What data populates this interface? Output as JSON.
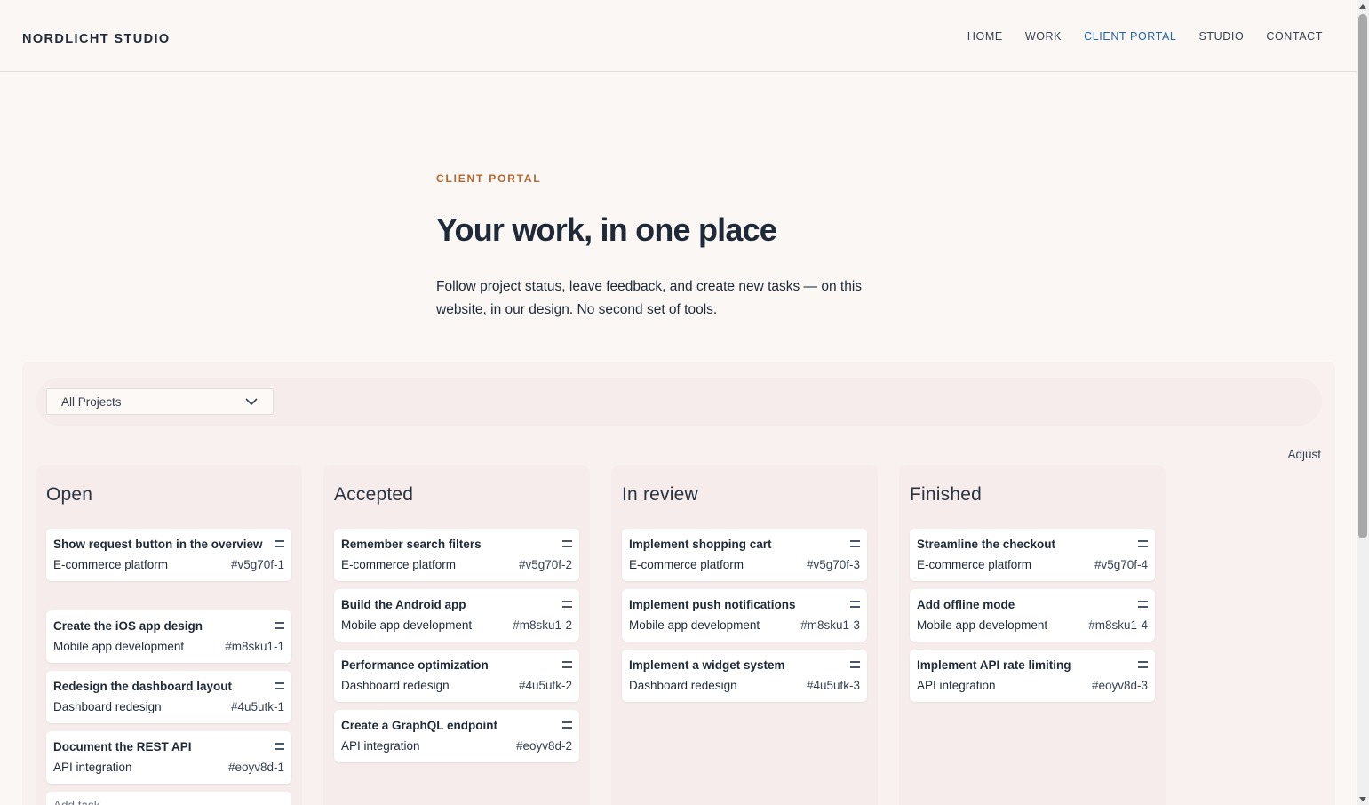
{
  "brand": "NORDLICHT STUDIO",
  "nav": [
    {
      "label": "HOME",
      "active": false
    },
    {
      "label": "WORK",
      "active": false
    },
    {
      "label": "CLIENT PORTAL",
      "active": true
    },
    {
      "label": "STUDIO",
      "active": false
    },
    {
      "label": "CONTACT",
      "active": false
    }
  ],
  "hero": {
    "eyebrow": "CLIENT PORTAL",
    "title": "Your work, in one place",
    "description": "Follow project status, leave feedback, and create new tasks — on this website, in our design. No second set of tools."
  },
  "filter": {
    "project_select": "All Projects"
  },
  "adjust_label": "Adjust",
  "columns": [
    {
      "title": "Open",
      "cards": [
        {
          "title": "Show request button in the overview",
          "project": "E-commerce platform",
          "id": "#v5g70f-1"
        },
        {
          "title": "Create the iOS app design",
          "project": "Mobile app development",
          "id": "#m8sku1-1"
        },
        {
          "title": "Redesign the dashboard layout",
          "project": "Dashboard redesign",
          "id": "#4u5utk-1"
        },
        {
          "title": "Document the REST API",
          "project": "API integration",
          "id": "#eoyv8d-1"
        }
      ],
      "add_task": "Add task"
    },
    {
      "title": "Accepted",
      "cards": [
        {
          "title": "Remember search filters",
          "project": "E-commerce platform",
          "id": "#v5g70f-2"
        },
        {
          "title": "Build the Android app",
          "project": "Mobile app development",
          "id": "#m8sku1-2"
        },
        {
          "title": "Performance optimization",
          "project": "Dashboard redesign",
          "id": "#4u5utk-2"
        },
        {
          "title": "Create a GraphQL endpoint",
          "project": "API integration",
          "id": "#eoyv8d-2"
        }
      ]
    },
    {
      "title": "In review",
      "cards": [
        {
          "title": "Implement shopping cart",
          "project": "E-commerce platform",
          "id": "#v5g70f-3"
        },
        {
          "title": "Implement push notifications",
          "project": "Mobile app development",
          "id": "#m8sku1-3"
        },
        {
          "title": "Implement a widget system",
          "project": "Dashboard redesign",
          "id": "#4u5utk-3"
        }
      ]
    },
    {
      "title": "Finished",
      "cards": [
        {
          "title": "Streamline the checkout",
          "project": "E-commerce platform",
          "id": "#v5g70f-4"
        },
        {
          "title": "Add offline mode",
          "project": "Mobile app development",
          "id": "#m8sku1-4"
        },
        {
          "title": "Implement API rate limiting",
          "project": "API integration",
          "id": "#eoyv8d-3"
        }
      ]
    }
  ],
  "colors": {
    "accent": "#2563a6",
    "eyebrow": "#b5652e",
    "column_bg": "#f5eceb"
  }
}
